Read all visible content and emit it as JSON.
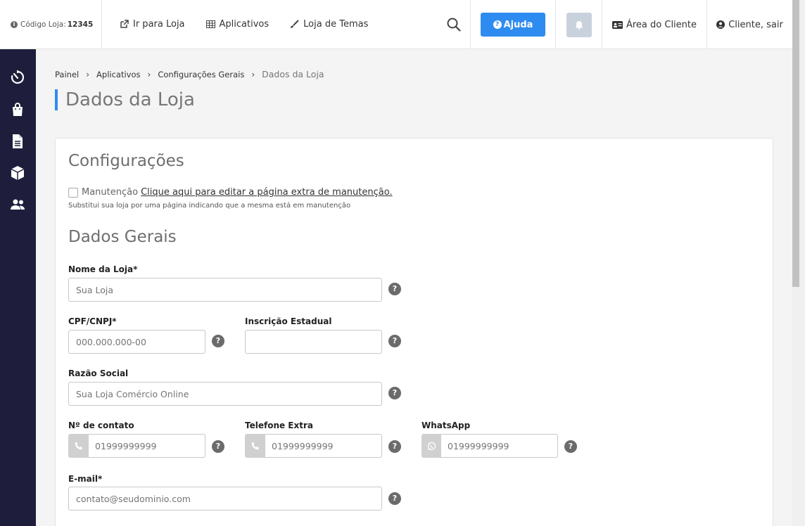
{
  "topbar": {
    "store_code_label": "Código Loja:",
    "store_code_value": "12345",
    "nav": [
      {
        "label": "Ir para Loja"
      },
      {
        "label": "Aplicativos"
      },
      {
        "label": "Loja de Temas"
      }
    ],
    "help_label": "Ajuda",
    "client_area_label": "Área do Cliente",
    "logout_label": "Cliente, sair"
  },
  "breadcrumb": {
    "items": [
      "Painel",
      "Aplicativos",
      "Configurações Gerais"
    ],
    "current": "Dados da Loja"
  },
  "page_title": "Dados da Loja",
  "config": {
    "heading": "Configurações",
    "maintenance_label": "Manutenção",
    "maintenance_link": "Clique aqui para editar a página extra de manutenção.",
    "maintenance_hint": "Substitui sua loja por uma página indicando que a mesma está em manutenção"
  },
  "general": {
    "heading": "Dados Gerais",
    "store_name": {
      "label": "Nome da Loja*",
      "placeholder": "Sua Loja"
    },
    "cpf_cnpj": {
      "label": "CPF/CNPJ*",
      "placeholder": "000.000.000-00"
    },
    "state_reg": {
      "label": "Inscrição Estadual",
      "placeholder": ""
    },
    "company_name": {
      "label": "Razão Social",
      "placeholder": "Sua Loja Comércio Online"
    },
    "contact_number": {
      "label": "Nº de contato",
      "placeholder": "01999999999"
    },
    "extra_phone": {
      "label": "Telefone Extra",
      "placeholder": "01999999999"
    },
    "whatsapp": {
      "label": "WhatsApp",
      "placeholder": "01999999999"
    },
    "email": {
      "label": "E-mail*",
      "placeholder": "contato@seudominio.com"
    }
  },
  "help_icon_glyph": "?",
  "colors": {
    "accent": "#2e8cf0",
    "sidebar": "#1e1e3c"
  }
}
